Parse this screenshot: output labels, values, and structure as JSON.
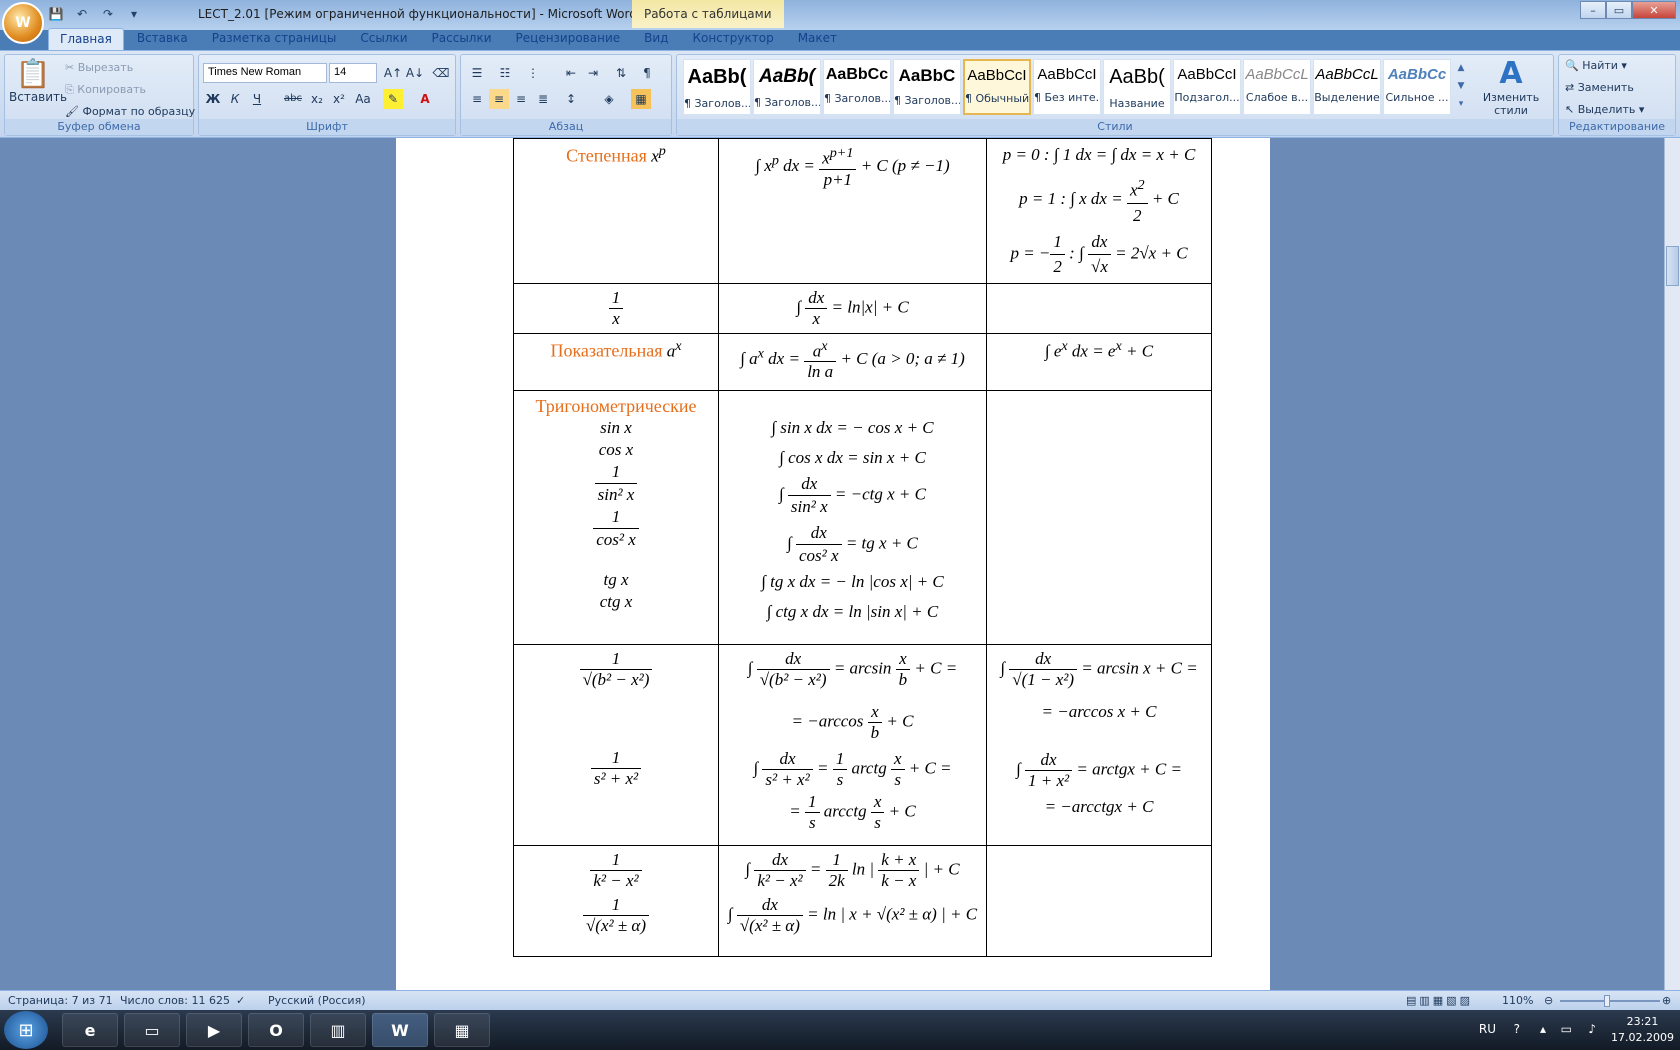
{
  "window": {
    "title": "LECT_2.01 [Режим ограниченной функциональности] - Microsoft Word",
    "context_tab": "Работа с таблицами"
  },
  "ribbon_tabs": [
    "Главная",
    "Вставка",
    "Разметка страницы",
    "Ссылки",
    "Рассылки",
    "Рецензирование",
    "Вид",
    "Конструктор",
    "Макет"
  ],
  "clipboard": {
    "paste": "Вставить",
    "cut": "Вырезать",
    "copy": "Копировать",
    "format_painter": "Формат по образцу",
    "label": "Буфер обмена"
  },
  "font": {
    "name": "Times New Roman",
    "size": "14",
    "label": "Шрифт",
    "bold": "Ж",
    "italic": "К",
    "underline": "Ч",
    "strike": "abc",
    "sub": "x₂",
    "sup": "x²",
    "case": "Aa",
    "grow": "A↑",
    "shrink": "A↓"
  },
  "paragraph": {
    "label": "Абзац",
    "pilcrow": "¶"
  },
  "styles": {
    "label": "Стили",
    "items": [
      {
        "sample": "AaBb(",
        "name": "¶ Заголов..."
      },
      {
        "sample": "AaBb(",
        "name": "¶ Заголов..."
      },
      {
        "sample": "AaBbCc",
        "name": "¶ Заголов..."
      },
      {
        "sample": "AaBbC",
        "name": "¶ Заголов..."
      },
      {
        "sample": "AaBbCcI",
        "name": "¶ Обычный"
      },
      {
        "sample": "AaBbCcI",
        "name": "¶ Без инте..."
      },
      {
        "sample": "AaBb(",
        "name": "Название"
      },
      {
        "sample": "AaBbCcI",
        "name": "Подзагол..."
      },
      {
        "sample": "AaBbCcL",
        "name": "Слабое в..."
      },
      {
        "sample": "AaBbCcL",
        "name": "Выделение"
      },
      {
        "sample": "AaBbCc",
        "name": "Сильное ..."
      }
    ],
    "change": "Изменить стили"
  },
  "editing": {
    "label": "Редактирование",
    "find": "Найти",
    "replace": "Заменить",
    "select": "Выделить"
  },
  "table": {
    "power_title": "Степенная",
    "power_var": "x",
    "power_exp": "p",
    "power_integral": [
      "∫ x",
      "p",
      " dx = ",
      "x",
      "p+1",
      "p+1",
      " + C  (p ≠ −1)"
    ],
    "power_cases": [
      "p = 0 :  ∫ 1 dx = ∫ dx =  x + C",
      "p = 1 :  ∫ x dx = ",
      "x",
      "2",
      "2",
      " + C",
      "p = −",
      "1",
      "2",
      " :  ∫ ",
      "dx",
      "√x",
      " = 2√x + C"
    ],
    "inv_num": "1",
    "inv_den": "x",
    "inv_integral": [
      "∫ ",
      "dx",
      "x",
      " = ln|x| + C"
    ],
    "exp_title": "Показательная",
    "exp_var": "a",
    "exp_sup": "x",
    "exp_integral": [
      "∫ a",
      "x",
      " dx = ",
      "a",
      "x",
      "ln a",
      " + C  (a > 0; a ≠ 1)"
    ],
    "exp_e": [
      "∫ e",
      "x",
      " dx = e",
      "x",
      " + C"
    ],
    "trig_title": "Тригонометрические",
    "trig_funcs": [
      "sin x",
      "cos x",
      "1",
      "sin² x",
      "1",
      "cos² x",
      "tg x",
      "ctg x"
    ],
    "trig_integrals": [
      "∫ sin x dx = − cos x + C",
      "∫ cos x dx = sin x + C",
      "∫ ",
      "dx",
      "sin² x",
      " = −ctg x + C",
      "∫ ",
      "dx",
      "cos² x",
      " = tg x + C",
      "∫ tg x dx = − ln |cos x| + C",
      "∫ ctg x dx = ln |sin x| + C"
    ],
    "arc_func": [
      "1",
      "√(b² − x²)",
      "1",
      "s² + x²"
    ],
    "arc_integrals": [
      "∫ ",
      "dx",
      "√(b² − x²)",
      " = arcsin ",
      "x",
      "b",
      " + C =",
      "= −arccos ",
      "x",
      "b",
      " + C",
      "∫ ",
      "dx",
      "s² + x²",
      " = ",
      "1",
      "s",
      " arctg ",
      "x",
      "s",
      " + C =",
      "= ",
      "1",
      "s",
      " arcctg ",
      "x",
      "s",
      " + C"
    ],
    "arc_special": [
      "∫ ",
      "dx",
      "√(1 − x²)",
      " = arcsin x + C =",
      "= −arccos x + C",
      "∫ ",
      "dx",
      "1 + x²",
      " = arctgx + C =",
      "= −arcctgx + C"
    ],
    "log_func": [
      "1",
      "k² − x²",
      "1",
      "√(x² ± α)"
    ],
    "log_integrals": [
      "∫ ",
      "dx",
      "k² − x²",
      " = ",
      "1",
      "2k",
      " ln | ",
      "k + x",
      "k − x",
      " | + C",
      "∫ ",
      "dx",
      "√(x² ± α)",
      " = ln | x + √(x² ± α) | + C"
    ]
  },
  "status": {
    "page": "Страница: 7 из 71",
    "words": "Число слов: 11 625",
    "language": "Русский (Россия)",
    "zoom": "110%"
  },
  "taskbar": {
    "lang": "RU",
    "time": "23:21",
    "date": "17.02.2009"
  }
}
